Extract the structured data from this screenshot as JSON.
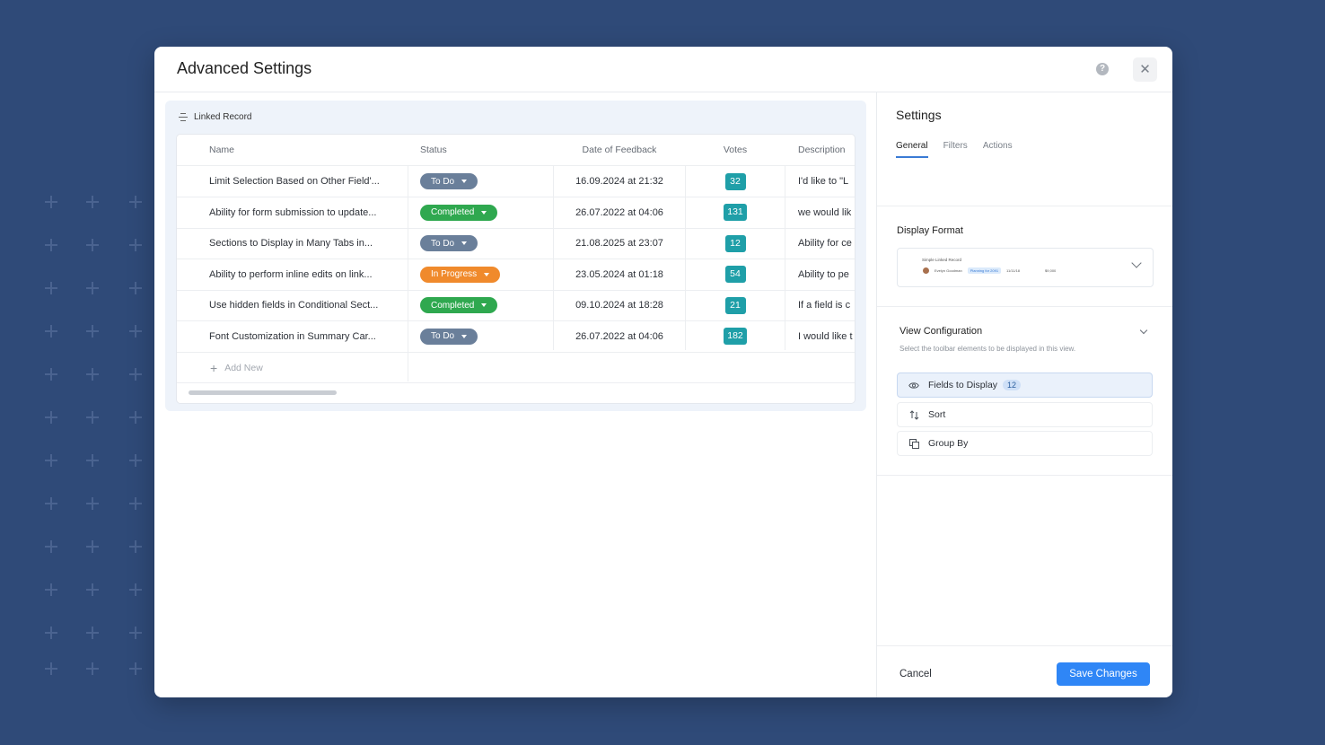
{
  "colors": {
    "background": "#2f4a78",
    "accent": "#2f86f6",
    "status_todo": "#6a7f9a",
    "status_completed": "#2fa84f",
    "status_in_progress": "#f08a2c",
    "vote_badge": "#1f9fa8"
  },
  "modal": {
    "title": "Advanced Settings",
    "help_icon": "question-circle-icon",
    "close_icon": "close-icon"
  },
  "linked_record": {
    "title": "Linked Record",
    "icon": "list-icon",
    "columns": [
      "Name",
      "Status",
      "Date of Feedback",
      "Votes",
      "Description"
    ],
    "rows": [
      {
        "name": "Limit Selection Based on Other Field'...",
        "status": "To Do",
        "status_color": "#6a7f9a",
        "date": "16.09.2024 at 21:32",
        "votes": "32",
        "description": "I'd like to \"L"
      },
      {
        "name": "Ability for form submission to update...",
        "status": "Completed",
        "status_color": "#2fa84f",
        "date": "26.07.2022 at 04:06",
        "votes": "131",
        "description": "we would lik"
      },
      {
        "name": "Sections to Display in Many Tabs in...",
        "status": "To Do",
        "status_color": "#6a7f9a",
        "date": "21.08.2025 at 23:07",
        "votes": "12",
        "description": "Ability for ce"
      },
      {
        "name": "Ability to perform inline edits on link...",
        "status": "In Progress",
        "status_color": "#f08a2c",
        "date": "23.05.2024 at 01:18",
        "votes": "54",
        "description": "Ability to pe"
      },
      {
        "name": "Use hidden fields in Conditional Sect...",
        "status": "Completed",
        "status_color": "#2fa84f",
        "date": "09.10.2024 at 18:28",
        "votes": "21",
        "description": "If a field is c"
      },
      {
        "name": "Font Customization in Summary Car...",
        "status": "To Do",
        "status_color": "#6a7f9a",
        "date": "26.07.2022 at 04:06",
        "votes": "182",
        "description": "I would like t"
      }
    ],
    "add_new_label": "Add New"
  },
  "settings": {
    "title": "Settings",
    "tabs": [
      {
        "label": "General",
        "active": true
      },
      {
        "label": "Filters",
        "active": false
      },
      {
        "label": "Actions",
        "active": false
      }
    ],
    "display_format": {
      "label": "Display Format",
      "preview_title": "Simple Linked Record",
      "preview_name": "Evelyn Goodman",
      "preview_tag": "Planning for 2091",
      "preview_date": "11/11/18",
      "preview_amount": "$9,000"
    },
    "view_configuration": {
      "label": "View Configuration",
      "subtitle": "Select the toolbar elements to be displayed in this view.",
      "items": [
        {
          "label": "Fields to Display",
          "icon": "eye-icon",
          "badge": "12",
          "selected": true
        },
        {
          "label": "Sort",
          "icon": "sort-icon",
          "selected": false
        },
        {
          "label": "Group By",
          "icon": "group-icon",
          "selected": false
        }
      ]
    }
  },
  "footer": {
    "cancel_label": "Cancel",
    "save_label": "Save Changes"
  }
}
